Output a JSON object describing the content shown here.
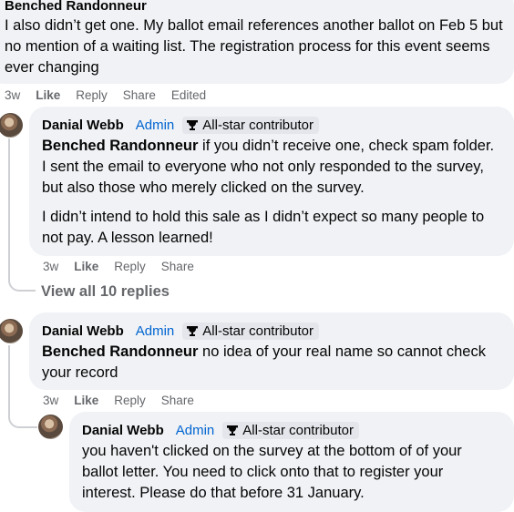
{
  "comments": [
    {
      "author": "Benched Randonneur",
      "text": "I also didn’t get one. My ballot email references another ballot on Feb 5 but no mention of a waiting list. The registration process for this event seems ever changing",
      "meta": {
        "time": "3w",
        "like": "Like",
        "reply": "Reply",
        "share": "Share",
        "edited": "Edited"
      }
    },
    {
      "author": "Danial Webb",
      "role": "Admin",
      "badge": "All-star contributor",
      "mention": "Benched Randonneur",
      "text_p1": " if you didn’t receive one, check spam folder. I sent the email to everyone who not only responded to the survey, but also those who merely clicked on the survey.",
      "text_p2": "I didn’t intend to hold this sale as I didn’t expect so many people to not pay. A lesson learned!",
      "meta": {
        "time": "3w",
        "like": "Like",
        "reply": "Reply",
        "share": "Share"
      }
    },
    {
      "author": "Danial Webb",
      "role": "Admin",
      "badge": "All-star contributor",
      "mention": "Benched Randonneur",
      "text": " no idea of your real name so cannot check your record",
      "meta": {
        "time": "3w",
        "like": "Like",
        "reply": "Reply",
        "share": "Share"
      }
    },
    {
      "author": "Danial Webb",
      "role": "Admin",
      "badge": "All-star contributor",
      "text": "you haven't clicked on the survey at the bottom of of your ballot letter. You need to click onto that to register your interest. Please do that before 31 January."
    }
  ],
  "view_all_replies": "View all 10 replies",
  "icons": {
    "badge": "trophy-icon",
    "avatar": "user-avatar"
  }
}
